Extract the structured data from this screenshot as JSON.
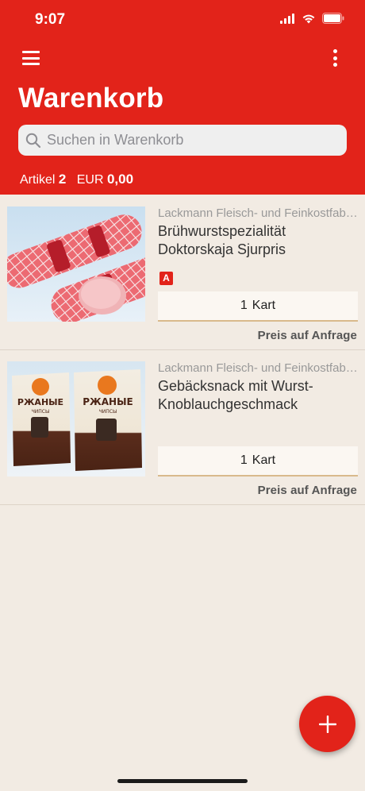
{
  "status": {
    "time": "9:07"
  },
  "header": {
    "title": "Warenkorb",
    "search_placeholder": "Suchen in Warenkorb",
    "summary": {
      "articles_label": "Artikel",
      "articles_count": "2",
      "currency": "EUR",
      "total": "0,00"
    }
  },
  "items": [
    {
      "supplier": "Lackmann Fleisch- und Feinkostfabrik",
      "name": "Brühwurstspezialität Doktorskaja Sjurpris",
      "badge": "A",
      "qty": "1",
      "unit": "Kart",
      "price": "Preis auf Anfrage"
    },
    {
      "supplier": "Lackmann Fleisch- und Feinkostfabrik",
      "name": "Gebäcksnack mit Wurst-Knoblauchgeschmack",
      "qty": "1",
      "unit": "Kart",
      "price": "Preis auf Anfrage",
      "package_text": "РЖАНЫЕ",
      "package_subtext": "ЧИПСЫ"
    }
  ],
  "colors": {
    "brand": "#e2231a",
    "background": "#f2ebe3"
  },
  "icons": {
    "menu": "hamburger-icon",
    "more": "more-vertical-icon",
    "search": "search-icon",
    "add": "plus-icon"
  }
}
